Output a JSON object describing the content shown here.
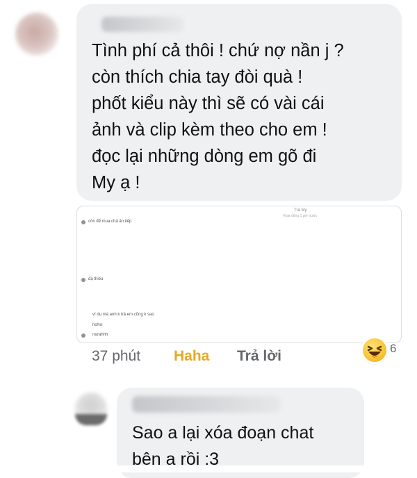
{
  "comment_1": {
    "author_name": "",
    "text": "Tình phí cả thôi ! chứ nợ nần j ?\ncòn thích chia tay đòi quà !\nphốt kiểu này thì sẽ có vài cái\nảnh và clip kèm theo cho em !\nđọc lại những dòng em gõ đi\nMy ạ !",
    "attachment": {
      "title": "Trà My",
      "subtitle": "Hoạt động 1 giờ trước",
      "messages": [
        "còn để mua chả ăn tiếp",
        "đạ thiếu",
        "ví dụ mà anh k trả em cũng k sao",
        "hơhơ",
        "mưahhh"
      ]
    },
    "time": "37 phút",
    "reaction_label": "Haha",
    "reply_label": "Trả lời",
    "reaction_emoji": "haha-emoji",
    "reaction_count": "6"
  },
  "comment_2": {
    "author_name": "",
    "text": "Sao a lại xóa đoạn chat\nbên a rồi :3"
  },
  "colors": {
    "bubble": "#eff0f2",
    "meta_text": "#65676b",
    "haha": "#e8a823"
  }
}
